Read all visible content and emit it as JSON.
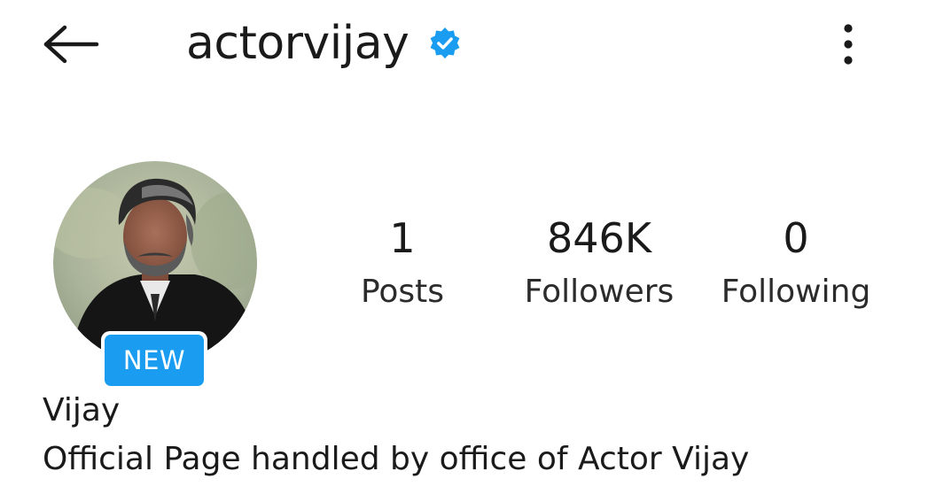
{
  "header": {
    "username": "actorvijay",
    "verified": true,
    "back_icon": "arrow-left-icon",
    "more_icon": "vertical-dots-icon",
    "verified_icon": "verified-badge-icon",
    "verified_color": "#1a9cf0"
  },
  "profile": {
    "avatar_alt": "profile photo",
    "badge": "NEW",
    "badge_color": "#1a9cf0",
    "display_name": "Vijay",
    "bio": "Official Page handled by office of Actor Vijay"
  },
  "stats": {
    "posts": {
      "value": "1",
      "label": "Posts"
    },
    "followers": {
      "value": "846K",
      "label": "Followers"
    },
    "following": {
      "value": "0",
      "label": "Following"
    }
  }
}
